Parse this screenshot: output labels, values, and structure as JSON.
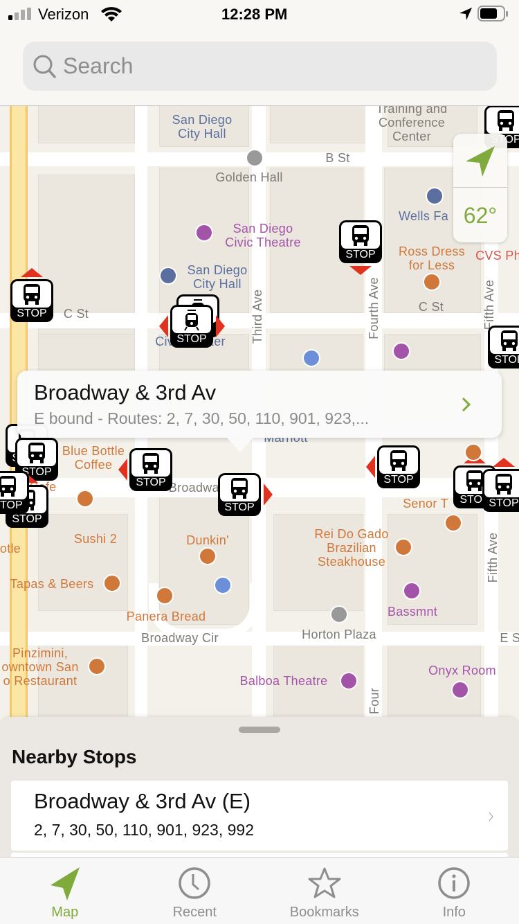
{
  "status_bar": {
    "carrier": "Verizon",
    "time": "12:28 PM"
  },
  "search": {
    "placeholder": "Search"
  },
  "weather": {
    "temperature": "62°",
    "accent": "#7faa3c"
  },
  "map": {
    "labels": [
      {
        "text": "San Diego\nCity Hall",
        "kind": "civic"
      },
      {
        "text": "Training and\nConference\nCenter",
        "kind": "street"
      },
      {
        "text": "B St",
        "kind": "street"
      },
      {
        "text": "Golden Hall",
        "kind": "street"
      },
      {
        "text": "Wells Fa",
        "kind": "civic"
      },
      {
        "text": "San Diego\nCivic Theatre",
        "kind": "arts"
      },
      {
        "text": "Ross Dress\nfor Less",
        "kind": "food"
      },
      {
        "text": "CVS Ph",
        "kind": "pharmacy"
      },
      {
        "text": "San Diego\nCity Hall",
        "kind": "civic"
      },
      {
        "text": "C St",
        "kind": "street"
      },
      {
        "text": "C St",
        "kind": "street"
      },
      {
        "text": "Third Ave",
        "kind": "street",
        "vertical": true
      },
      {
        "text": "Fourth Ave",
        "kind": "street",
        "vertical": true
      },
      {
        "text": "Fifth Ave",
        "kind": "street",
        "vertical": true
      },
      {
        "text": "Civic Center",
        "kind": "civic"
      },
      {
        "text": "Marriott",
        "kind": "civic"
      },
      {
        "text": "Blue Bottle\nCoffee",
        "kind": "food"
      },
      {
        "text": "Cafe",
        "kind": "food"
      },
      {
        "text": "Broadway",
        "kind": "street"
      },
      {
        "text": "Senor T",
        "kind": "food"
      },
      {
        "text": "Rei Do Gado\nBrazilian\nSteakhouse",
        "kind": "food"
      },
      {
        "text": "Sushi 2",
        "kind": "food"
      },
      {
        "text": "Dunkin'",
        "kind": "food"
      },
      {
        "text": "otle",
        "kind": "food"
      },
      {
        "text": "Tapas & Beers",
        "kind": "food"
      },
      {
        "text": "Bassmnt",
        "kind": "arts"
      },
      {
        "text": "Fifth Ave",
        "kind": "street",
        "vertical": true
      },
      {
        "text": "Panera Bread",
        "kind": "food"
      },
      {
        "text": "Horton Plaza",
        "kind": "street"
      },
      {
        "text": "Broadway Cir",
        "kind": "street"
      },
      {
        "text": "Pinzimini,\nowntown San\no Restaurant",
        "kind": "food"
      },
      {
        "text": "Onyx Room",
        "kind": "arts"
      },
      {
        "text": "Balboa Theatre",
        "kind": "arts"
      },
      {
        "text": "E St",
        "kind": "street"
      },
      {
        "text": "Four",
        "kind": "street",
        "vertical": true
      }
    ],
    "label_colors": {
      "civic": "#5b6f9e",
      "street": "#7d7a75",
      "arts": "#a353a8",
      "food": "#d0783a",
      "pharmacy": "#d9534f"
    },
    "stop_label": "STOP",
    "stops": [
      {
        "arrow": "down",
        "type": "bus"
      },
      {
        "arrow": "up",
        "type": "bus"
      },
      {
        "arrow": "none",
        "type": "tram"
      },
      {
        "arrow": "both",
        "type": "tram"
      },
      {
        "arrow": "left",
        "type": "bus"
      },
      {
        "arrow": "right",
        "type": "bus"
      },
      {
        "arrow": "left",
        "type": "bus"
      },
      {
        "arrow": "none",
        "type": "bus"
      },
      {
        "arrow": "none",
        "type": "bus"
      },
      {
        "arrow": "up",
        "type": "bus"
      },
      {
        "arrow": "none",
        "type": "bus"
      },
      {
        "arrow": "up",
        "type": "bus"
      },
      {
        "arrow": "up",
        "type": "bus"
      },
      {
        "arrow": "none",
        "type": "bus"
      },
      {
        "arrow": "none",
        "type": "bus"
      }
    ],
    "arrow_color": "#e0321e"
  },
  "callout": {
    "title": "Broadway & 3rd Av",
    "subtitle": "E bound - Routes: 2, 7, 30, 50, 110, 901, 923,..."
  },
  "sheet": {
    "title": "Nearby Stops",
    "stops": [
      {
        "name": "Broadway & 3rd Av (E)",
        "routes": "2, 7, 30, 50, 110, 901, 923, 992"
      }
    ]
  },
  "tabs": [
    {
      "label": "Map",
      "icon": "location-arrow-icon",
      "active": true
    },
    {
      "label": "Recent",
      "icon": "clock-icon"
    },
    {
      "label": "Bookmarks",
      "icon": "star-icon"
    },
    {
      "label": "Info",
      "icon": "info-icon"
    }
  ]
}
